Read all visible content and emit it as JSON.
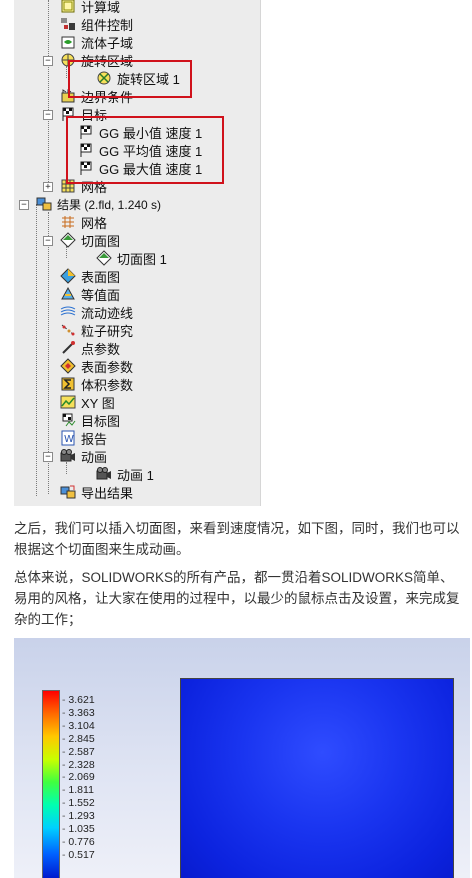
{
  "tree": {
    "items": [
      {
        "label": "计算域"
      },
      {
        "label": "组件控制"
      },
      {
        "label": "流体子域"
      },
      {
        "label": "旋转区域"
      },
      {
        "label": "旋转区域 1"
      },
      {
        "label": "边界条件"
      },
      {
        "label": "目标"
      },
      {
        "label": "GG 最小值 速度 1"
      },
      {
        "label": "GG 平均值 速度 1"
      },
      {
        "label": "GG 最大值 速度 1"
      },
      {
        "label": "网格"
      },
      {
        "label": "结果 (2.fld, 1.240 s)"
      },
      {
        "label": "网格"
      },
      {
        "label": "切面图"
      },
      {
        "label": "切面图 1"
      },
      {
        "label": "表面图"
      },
      {
        "label": "等值面"
      },
      {
        "label": "流动迹线"
      },
      {
        "label": "粒子研究"
      },
      {
        "label": "点参数"
      },
      {
        "label": "表面参数"
      },
      {
        "label": "体积参数"
      },
      {
        "label": "XY 图"
      },
      {
        "label": "目标图"
      },
      {
        "label": "报告"
      },
      {
        "label": "动画"
      },
      {
        "label": "动画 1"
      },
      {
        "label": "导出结果"
      }
    ],
    "highlight_color": "#d0111b"
  },
  "paragraphs": [
    "之后，我们可以插入切面图，来看到速度情况，如下图，同时，我们也可以根据这个切面图来生成动画。",
    "总体来说，SOLIDWORKS的所有产品，都一贯沿着SOLIDWORKS简单、易用的风格，让大家在使用的过程中，以最少的鼠标点击及设置，来完成复杂的工作；"
  ],
  "legend": {
    "values": [
      "3.621",
      "3.363",
      "3.104",
      "2.845",
      "2.587",
      "2.328",
      "2.069",
      "1.811",
      "1.552",
      "1.293",
      "1.035",
      "0.776",
      "0.517"
    ]
  }
}
